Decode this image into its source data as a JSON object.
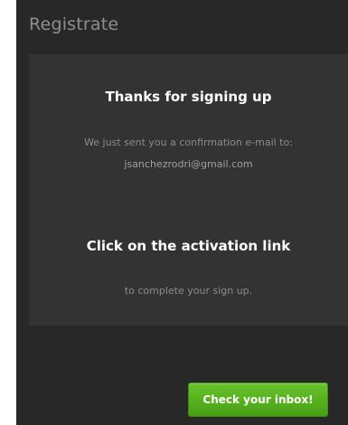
{
  "dialog": {
    "title": "Registrate"
  },
  "panel": {
    "thanks_heading": "Thanks for signing up",
    "sent_message": "We just sent you a confirmation e-mail to:",
    "email": "jsanchezrodri@gmail.com",
    "activation_heading": "Click on the activation link",
    "complete_message": "to complete your sign up."
  },
  "actions": {
    "inbox_button_label": "Check your inbox!"
  },
  "colors": {
    "dialog_background": "#282828",
    "panel_background": "#333333",
    "button_green": "#5ab520"
  }
}
